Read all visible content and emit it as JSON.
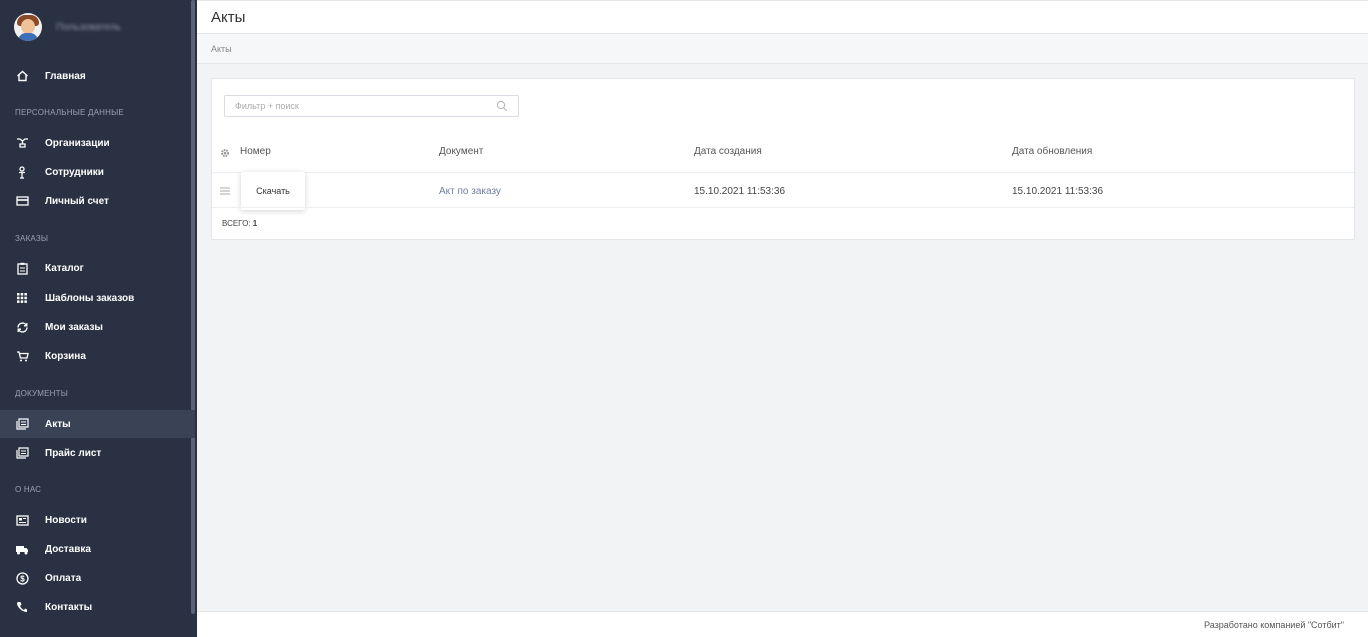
{
  "sidebar": {
    "user_name": "Пользователь",
    "items": [
      {
        "label": "Главная",
        "icon": "home-icon"
      },
      {
        "label": "Организации",
        "icon": "org-icon"
      },
      {
        "label": "Сотрудники",
        "icon": "person-icon"
      },
      {
        "label": "Личный счет",
        "icon": "card-icon"
      },
      {
        "label": "Каталог",
        "icon": "clipboard-icon"
      },
      {
        "label": "Шаблоны заказов",
        "icon": "grid-icon"
      },
      {
        "label": "Мои заказы",
        "icon": "refresh-icon"
      },
      {
        "label": "Корзина",
        "icon": "cart-icon"
      },
      {
        "label": "Акты",
        "icon": "docs-icon"
      },
      {
        "label": "Прайс лист",
        "icon": "docs-icon"
      },
      {
        "label": "Новости",
        "icon": "news-icon"
      },
      {
        "label": "Доставка",
        "icon": "truck-icon"
      },
      {
        "label": "Оплата",
        "icon": "dollar-icon"
      },
      {
        "label": "Контакты",
        "icon": "phone-icon"
      }
    ],
    "sections": [
      "Персональные данные",
      "Заказы",
      "Документы",
      "О нас"
    ],
    "active": "Акты"
  },
  "header": {
    "title": "Акты"
  },
  "breadcrumb": "Акты",
  "search": {
    "placeholder": "Фильтр + поиск",
    "value": ""
  },
  "table": {
    "headers": [
      "Номер",
      "Документ",
      "Дата создания",
      "Дата обновления"
    ],
    "rows": [
      {
        "number": "",
        "document": "Акт по заказу",
        "created": "15.10.2021 11:53:36",
        "updated": "15.10.2021 11:53:36"
      }
    ],
    "row_menu": {
      "download_label": "Скачать"
    },
    "total_label": "ВСЕГО:",
    "total_value": "1"
  },
  "footer": {
    "text": "Разработано компанией \"Сотбит\""
  },
  "colors": {
    "sidebar_bg": "#2a3142",
    "active_bg": "#3a4256",
    "link": "#6f7f9e"
  }
}
